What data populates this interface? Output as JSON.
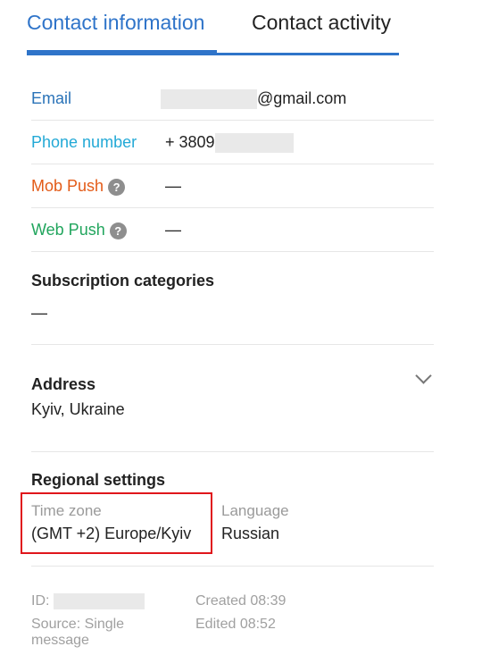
{
  "tabs": [
    {
      "label": "Contact information",
      "active": true
    },
    {
      "label": "Contact activity",
      "active": false
    }
  ],
  "fields": {
    "email": {
      "label": "Email",
      "value_suffix": "@gmail.com"
    },
    "phone": {
      "label": "Phone number",
      "value_prefix": "+ 3809"
    },
    "mob_push": {
      "label": "Mob Push",
      "value": "—",
      "help_icon": "help-icon"
    },
    "web_push": {
      "label": "Web Push",
      "value": "—",
      "help_icon": "help-icon"
    }
  },
  "subscription": {
    "title": "Subscription categories",
    "value": "—"
  },
  "address": {
    "title": "Address",
    "value": "Kyiv, Ukraine"
  },
  "regional": {
    "title": "Regional settings",
    "timezone_label": "Time zone",
    "timezone_value": "(GMT +2) Europe/Kyiv",
    "language_label": "Language",
    "language_value": "Russian"
  },
  "meta": {
    "id_label": "ID:",
    "source_line1": "Source:  Single",
    "source_line2": "message",
    "created": "Created 08:39",
    "edited": "Edited 08:52"
  },
  "colors": {
    "accent": "#2f74c9",
    "email": "#2a73b8",
    "phone": "#23a9d6",
    "mob_push": "#e35b18",
    "web_push": "#21a55d",
    "highlight": "#e0161b"
  }
}
